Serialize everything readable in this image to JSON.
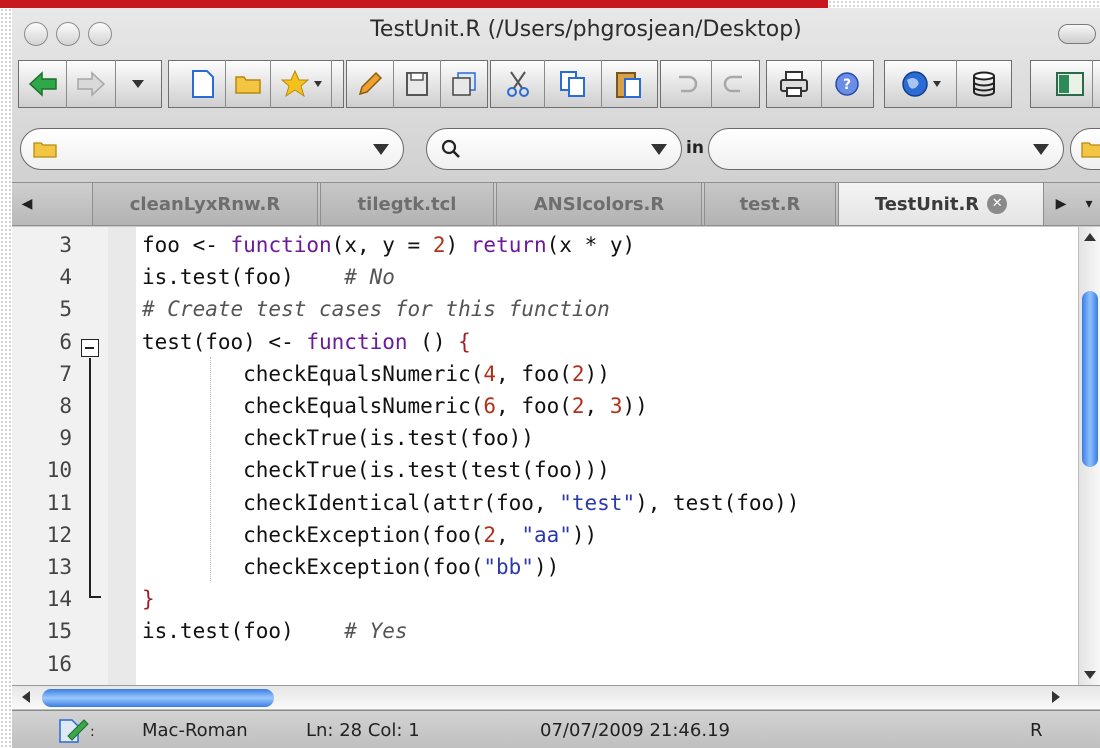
{
  "window": {
    "title": "TestUnit.R (/Users/phgrosjean/Desktop)"
  },
  "toolbar": {
    "buttons": [
      {
        "name": "back-icon"
      },
      {
        "name": "forward-icon"
      },
      {
        "name": "history-dropdown-icon"
      },
      {
        "name": "new-document-icon"
      },
      {
        "name": "open-folder-icon"
      },
      {
        "name": "bookmark-star-icon"
      },
      {
        "name": "edit-pencil-icon"
      },
      {
        "name": "save-icon"
      },
      {
        "name": "save-all-icon"
      },
      {
        "name": "cut-icon"
      },
      {
        "name": "copy-icon"
      },
      {
        "name": "paste-icon"
      },
      {
        "name": "undo-icon"
      },
      {
        "name": "redo-icon"
      },
      {
        "name": "print-icon"
      },
      {
        "name": "help-icon"
      },
      {
        "name": "globe-icon"
      },
      {
        "name": "database-icon"
      },
      {
        "name": "pane-left-icon"
      }
    ]
  },
  "search": {
    "folder_value": "",
    "search_value": "",
    "in_label": "in",
    "scope_value": ""
  },
  "tabs": [
    {
      "label": "cleanLyxRnw.R",
      "active": false
    },
    {
      "label": "tilegtk.tcl",
      "active": false
    },
    {
      "label": "ANSIcolors.R",
      "active": false
    },
    {
      "label": "test.R",
      "active": false
    },
    {
      "label": "TestUnit.R",
      "active": true
    }
  ],
  "editor": {
    "line_numbers": [
      "3",
      "4",
      "5",
      "6",
      "7",
      "8",
      "9",
      "10",
      "11",
      "12",
      "13",
      "14",
      "15",
      "16"
    ],
    "lines": [
      "foo <- function(x, y = 2) return(x * y)",
      "is.test(foo)    # No",
      "# Create test cases for this function",
      "test(foo) <- function () {",
      "        checkEqualsNumeric(4, foo(2))",
      "        checkEqualsNumeric(6, foo(2, 3))",
      "        checkTrue(is.test(foo))",
      "        checkTrue(is.test(test(foo)))",
      "        checkIdentical(attr(foo, \"test\"), test(foo))",
      "        checkException(foo(2, \"aa\"))",
      "        checkException(foo(\"bb\"))",
      "}",
      "is.test(foo)    # Yes",
      ""
    ]
  },
  "status": {
    "encoding": "Mac-Roman",
    "position": "Ln: 28 Col: 1",
    "datetime": "07/07/2009 21:46.19",
    "language": "R"
  },
  "colors": {
    "accent": "#c8181e",
    "keyword": "#6a1a9a",
    "number": "#b0301c",
    "string": "#2a3aa8",
    "scroll_thumb": "#3a7de0"
  }
}
